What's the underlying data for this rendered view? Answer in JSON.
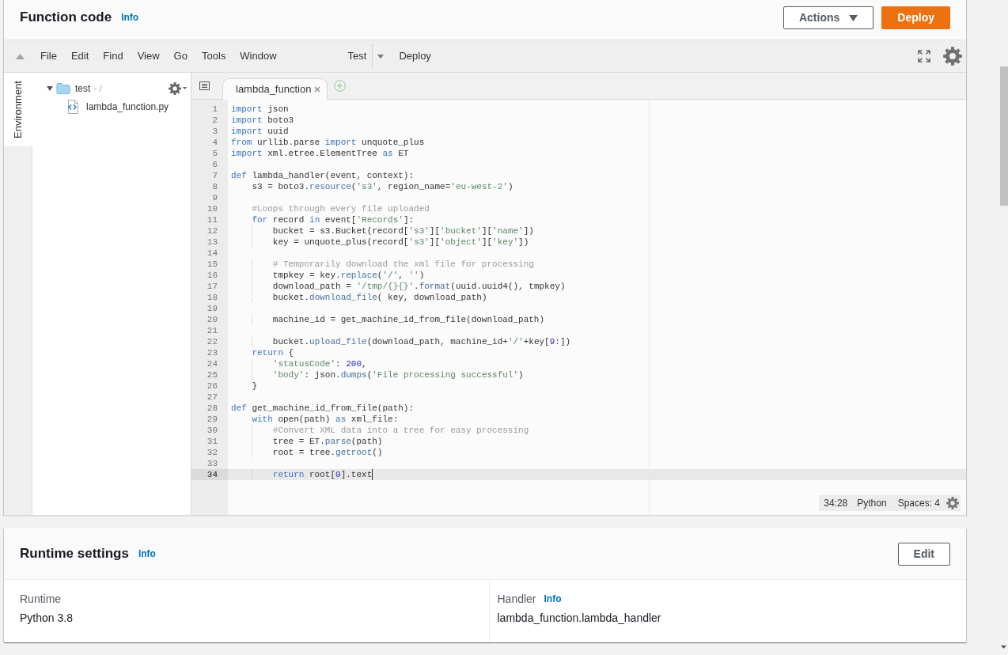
{
  "function_code": {
    "title": "Function code",
    "info_link": "Info",
    "buttons": [
      {
        "kind": "dropdown",
        "label": "Actions"
      },
      {
        "kind": "primary",
        "label": "Deploy"
      }
    ]
  },
  "ide": {
    "menu": [
      "File",
      "Edit",
      "Find",
      "View",
      "Go",
      "Tools",
      "Window"
    ],
    "run_button": "Test",
    "deploy_button": "Deploy",
    "side_tabs": [
      {
        "label": "Environment",
        "selected": true
      }
    ],
    "file_tree": [
      {
        "kind": "folder",
        "name": "test",
        "path": "- /",
        "expanded": true,
        "children": [
          {
            "kind": "file",
            "name": "lambda_function.py"
          }
        ]
      }
    ],
    "tabs": [
      {
        "label": "lambda_function",
        "selected": true
      }
    ],
    "lines": [
      {
        "number": "1",
        "active": false,
        "tokens": [
          {
            "kind": "keyword",
            "text": "import"
          },
          {
            "kind": "plain",
            "text": " json"
          }
        ]
      },
      {
        "number": "2",
        "active": false,
        "tokens": [
          {
            "kind": "keyword",
            "text": "import"
          },
          {
            "kind": "plain",
            "text": " boto3"
          }
        ]
      },
      {
        "number": "3",
        "active": false,
        "tokens": [
          {
            "kind": "keyword",
            "text": "import"
          },
          {
            "kind": "plain",
            "text": " uuid"
          }
        ]
      },
      {
        "number": "4",
        "active": false,
        "tokens": [
          {
            "kind": "keyword",
            "text": "from"
          },
          {
            "kind": "plain",
            "text": " urllib.parse "
          },
          {
            "kind": "keyword",
            "text": "import"
          },
          {
            "kind": "plain",
            "text": " unquote_plus"
          }
        ]
      },
      {
        "number": "5",
        "active": false,
        "tokens": [
          {
            "kind": "keyword",
            "text": "import"
          },
          {
            "kind": "plain",
            "text": " xml.etree.ElementTree "
          },
          {
            "kind": "keyword",
            "text": "as"
          },
          {
            "kind": "plain",
            "text": " ET"
          }
        ]
      },
      {
        "number": "6",
        "active": false
      },
      {
        "number": "7",
        "active": false,
        "tokens": [
          {
            "kind": "keyword",
            "text": "def"
          },
          {
            "kind": "plain",
            "text": " lambda_handler(event, context):"
          }
        ]
      },
      {
        "number": "8",
        "active": false,
        "tokens": [
          {
            "kind": "plain",
            "text": "    s3 = boto3."
          },
          {
            "kind": "method",
            "text": "resource"
          },
          {
            "kind": "plain",
            "text": "("
          },
          {
            "kind": "string",
            "text": "'s3'"
          },
          {
            "kind": "plain",
            "text": ", region_name="
          },
          {
            "kind": "string",
            "text": "'eu-west-2'"
          },
          {
            "kind": "plain",
            "text": ")"
          }
        ]
      },
      {
        "number": "9",
        "active": false
      },
      {
        "number": "10",
        "active": false,
        "tokens": [
          {
            "kind": "comment",
            "text": "    #Loops through every file uploaded"
          }
        ]
      },
      {
        "number": "11",
        "active": false,
        "tokens": [
          {
            "kind": "keyword",
            "text": "    for"
          },
          {
            "kind": "plain",
            "text": " record "
          },
          {
            "kind": "keyword",
            "text": "in"
          },
          {
            "kind": "plain",
            "text": " event["
          },
          {
            "kind": "string",
            "text": "'Records'"
          },
          {
            "kind": "plain",
            "text": "]:"
          }
        ]
      },
      {
        "number": "12",
        "active": false,
        "tokens": [
          {
            "kind": "plain",
            "text": "        bucket = s3.Bucket(record["
          },
          {
            "kind": "string",
            "text": "'s3'"
          },
          {
            "kind": "plain",
            "text": "]["
          },
          {
            "kind": "string",
            "text": "'bucket'"
          },
          {
            "kind": "plain",
            "text": "]["
          },
          {
            "kind": "string",
            "text": "'name'"
          },
          {
            "kind": "plain",
            "text": "])"
          }
        ]
      },
      {
        "number": "13",
        "active": false,
        "tokens": [
          {
            "kind": "plain",
            "text": "        key = unquote_plus(record["
          },
          {
            "kind": "string",
            "text": "'s3'"
          },
          {
            "kind": "plain",
            "text": "]["
          },
          {
            "kind": "string",
            "text": "'object'"
          },
          {
            "kind": "plain",
            "text": "]["
          },
          {
            "kind": "string",
            "text": "'key'"
          },
          {
            "kind": "plain",
            "text": "])"
          }
        ]
      },
      {
        "number": "14",
        "active": false
      },
      {
        "number": "15",
        "active": false,
        "tokens": [
          {
            "kind": "comment",
            "text": "        # Temporarily download the xml file for processing"
          }
        ]
      },
      {
        "number": "16",
        "active": false,
        "tokens": [
          {
            "kind": "plain",
            "text": "        tmpkey = key."
          },
          {
            "kind": "method",
            "text": "replace"
          },
          {
            "kind": "plain",
            "text": "("
          },
          {
            "kind": "string",
            "text": "'/'"
          },
          {
            "kind": "plain",
            "text": ", "
          },
          {
            "kind": "string",
            "text": "''"
          },
          {
            "kind": "plain",
            "text": ")"
          }
        ]
      },
      {
        "number": "17",
        "active": false,
        "tokens": [
          {
            "kind": "plain",
            "text": "        download_path = "
          },
          {
            "kind": "string",
            "text": "'/tmp/{}{}'"
          },
          {
            "kind": "plain",
            "text": "."
          },
          {
            "kind": "method",
            "text": "format"
          },
          {
            "kind": "plain",
            "text": "(uuid.uuid4(), tmpkey)"
          }
        ]
      },
      {
        "number": "18",
        "active": false,
        "tokens": [
          {
            "kind": "plain",
            "text": "        bucket."
          },
          {
            "kind": "method",
            "text": "download_file"
          },
          {
            "kind": "plain",
            "text": "( key, download_path)"
          }
        ]
      },
      {
        "number": "19",
        "active": false
      },
      {
        "number": "20",
        "active": false,
        "tokens": [
          {
            "kind": "plain",
            "text": "        machine_id = get_machine_id_from_file(download_path)"
          }
        ]
      },
      {
        "number": "21",
        "active": false
      },
      {
        "number": "22",
        "active": false,
        "tokens": [
          {
            "kind": "plain",
            "text": "        bucket."
          },
          {
            "kind": "method",
            "text": "upload_file"
          },
          {
            "kind": "plain",
            "text": "(download_path, machine_id+"
          },
          {
            "kind": "string",
            "text": "'/'"
          },
          {
            "kind": "plain",
            "text": "+key["
          },
          {
            "kind": "number",
            "text": "9"
          },
          {
            "kind": "plain",
            "text": ":])"
          }
        ]
      },
      {
        "number": "23",
        "active": false,
        "tokens": [
          {
            "kind": "keyword",
            "text": "    return"
          },
          {
            "kind": "plain",
            "text": " {"
          }
        ]
      },
      {
        "number": "24",
        "active": false,
        "tokens": [
          {
            "kind": "string",
            "text": "        'statusCode'"
          },
          {
            "kind": "plain",
            "text": ": "
          },
          {
            "kind": "number",
            "text": "200"
          },
          {
            "kind": "plain",
            "text": ","
          }
        ]
      },
      {
        "number": "25",
        "active": false,
        "tokens": [
          {
            "kind": "string",
            "text": "        'body'"
          },
          {
            "kind": "plain",
            "text": ": json."
          },
          {
            "kind": "method",
            "text": "dumps"
          },
          {
            "kind": "plain",
            "text": "("
          },
          {
            "kind": "string",
            "text": "'File processing successful'"
          },
          {
            "kind": "plain",
            "text": ")"
          }
        ]
      },
      {
        "number": "26",
        "active": false,
        "tokens": [
          {
            "kind": "plain",
            "text": "    }"
          }
        ]
      },
      {
        "number": "27",
        "active": false
      },
      {
        "number": "28",
        "active": false,
        "tokens": [
          {
            "kind": "keyword",
            "text": "def"
          },
          {
            "kind": "plain",
            "text": " get_machine_id_from_file(path):"
          }
        ]
      },
      {
        "number": "29",
        "active": false,
        "tokens": [
          {
            "kind": "keyword",
            "text": "    with"
          },
          {
            "kind": "plain",
            "text": " open(path) "
          },
          {
            "kind": "keyword",
            "text": "as"
          },
          {
            "kind": "plain",
            "text": " xml_file:"
          }
        ]
      },
      {
        "number": "30",
        "active": false,
        "tokens": [
          {
            "kind": "comment",
            "text": "        #Convert XML data into a tree for easy processing"
          }
        ]
      },
      {
        "number": "31",
        "active": false,
        "tokens": [
          {
            "kind": "plain",
            "text": "        tree = ET."
          },
          {
            "kind": "method",
            "text": "parse"
          },
          {
            "kind": "plain",
            "text": "(path)"
          }
        ]
      },
      {
        "number": "32",
        "active": false,
        "tokens": [
          {
            "kind": "plain",
            "text": "        root = tree."
          },
          {
            "kind": "method",
            "text": "getroot"
          },
          {
            "kind": "plain",
            "text": "()"
          }
        ]
      },
      {
        "number": "33",
        "active": false
      },
      {
        "number": "34",
        "active": true,
        "tokens": [
          {
            "kind": "keyword",
            "text": "        return"
          },
          {
            "kind": "plain",
            "text": " root["
          },
          {
            "kind": "number",
            "text": "0"
          },
          {
            "kind": "plain",
            "text": "].text"
          }
        ]
      }
    ],
    "status": {
      "position": "34:28",
      "language": "Python",
      "indent": "Spaces: 4"
    }
  },
  "runtime_settings": {
    "title": "Runtime settings",
    "info_link": "Info",
    "edit_button": "Edit",
    "fields": [
      {
        "label": "Runtime",
        "value": "Python 3.8"
      },
      {
        "label": "Handler",
        "info_link": "Info",
        "value": "lambda_function.lambda_handler"
      }
    ]
  }
}
